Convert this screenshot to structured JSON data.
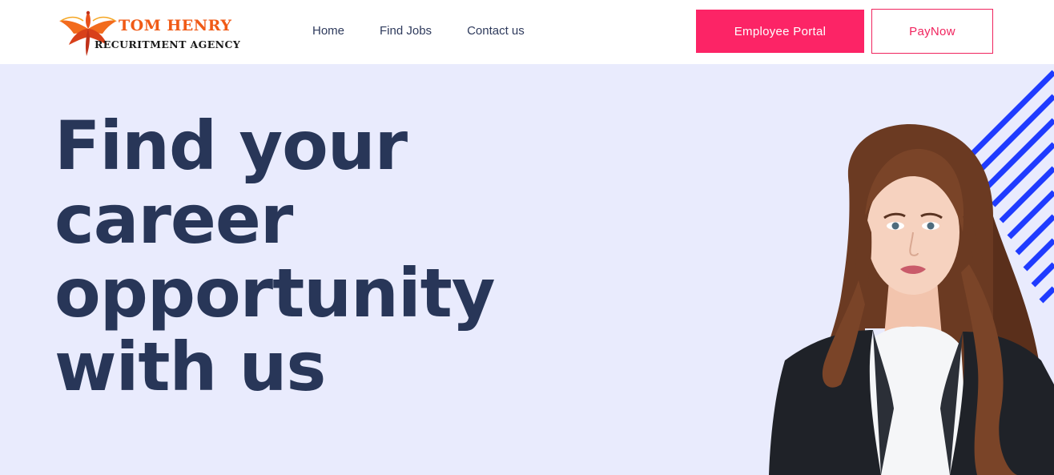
{
  "brand": {
    "name": "TOM HENRY",
    "subtitle": "RECURITMENT AGENCY",
    "logo_icon": "phoenix-bird-icon",
    "colors": {
      "primary": "#f05a16",
      "dark": "#1b1b1b"
    }
  },
  "nav": {
    "items": [
      {
        "label": "Home"
      },
      {
        "label": "Find Jobs"
      },
      {
        "label": "Contact us"
      }
    ]
  },
  "actions": {
    "employee_portal": "Employee Portal",
    "pay_now": "PayNow"
  },
  "hero": {
    "title_lines": [
      "Find your",
      "career",
      "opportunity",
      "with us"
    ],
    "image": "portrait-photo"
  },
  "colors": {
    "accent": "#fc2466",
    "hero_bg": "#e9ebfd",
    "heading": "#283658",
    "stripe": "#1f3bff"
  }
}
